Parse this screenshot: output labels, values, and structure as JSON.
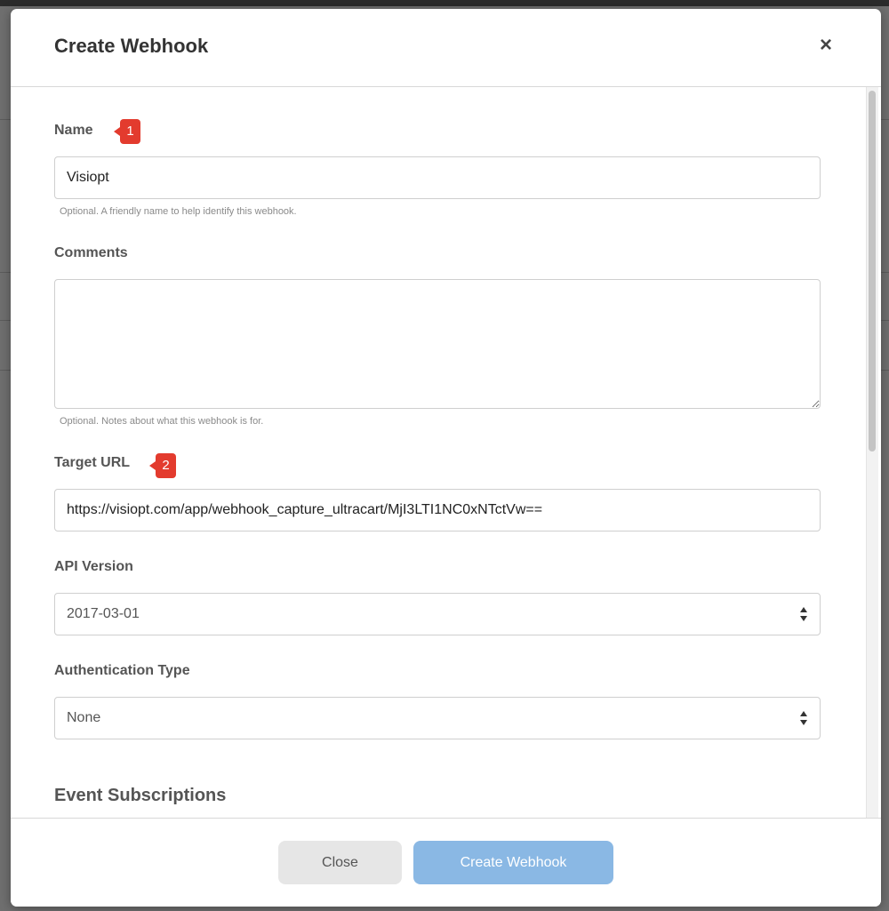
{
  "modal": {
    "title": "Create Webhook",
    "close_icon": "×"
  },
  "form": {
    "name": {
      "label": "Name",
      "value": "Visiopt",
      "help": "Optional. A friendly name to help identify this webhook.",
      "badge": "1"
    },
    "comments": {
      "label": "Comments",
      "value": "",
      "help": "Optional. Notes about what this webhook is for."
    },
    "target_url": {
      "label": "Target URL",
      "value": "https://visiopt.com/app/webhook_capture_ultracart/MjI3LTI1NC0xNTctVw==",
      "badge": "2"
    },
    "api_version": {
      "label": "API Version",
      "selected": "2017-03-01"
    },
    "auth_type": {
      "label": "Authentication Type",
      "selected": "None"
    },
    "event_subscriptions": {
      "title": "Event Subscriptions"
    }
  },
  "footer": {
    "close_label": "Close",
    "create_label": "Create Webhook"
  },
  "colors": {
    "badge": "#e33b2e",
    "primary_button": "#8ab8e4",
    "secondary_button": "#e6e6e6"
  },
  "icons": {
    "close": "close-icon",
    "select": "sort-arrows-icon",
    "resize": "resize-handle-icon"
  }
}
